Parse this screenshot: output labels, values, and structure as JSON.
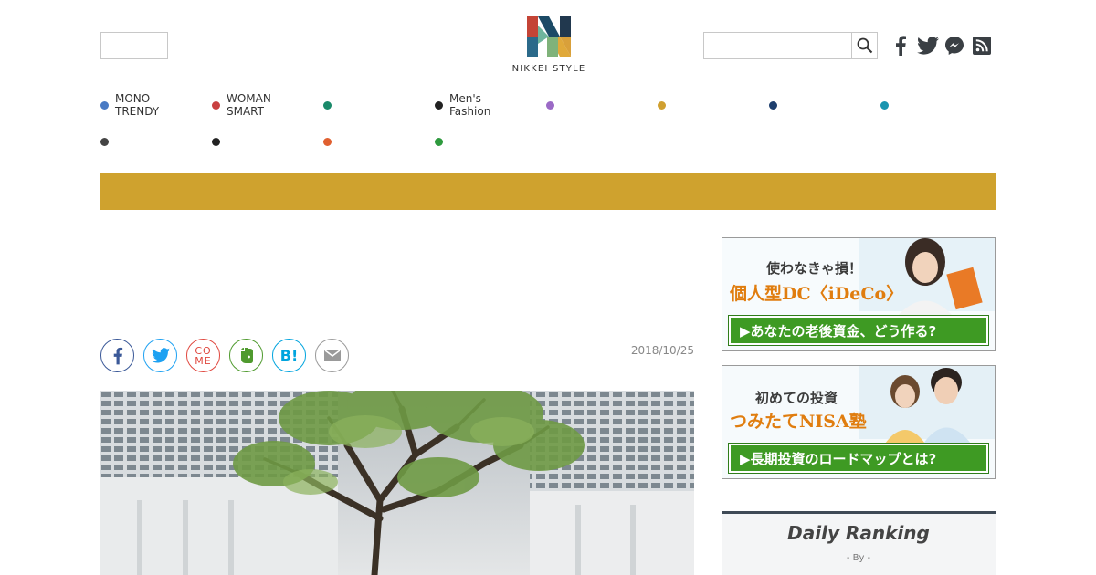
{
  "header": {
    "logo_text": "NIKKEI STYLE",
    "search": {
      "value": "",
      "placeholder": ""
    },
    "social": [
      "facebook-icon",
      "twitter-icon",
      "messenger-icon",
      "rss-icon"
    ]
  },
  "categories": [
    {
      "label": "MONO\nTRENDY",
      "color": "#4a7bc4"
    },
    {
      "label": "WOMAN\nSMART",
      "color": "#c94040"
    },
    {
      "label": "",
      "color": "#1a8a6a"
    },
    {
      "label": "Men's\nFashion",
      "color": "#222222"
    },
    {
      "label": "",
      "color": "#9b6ac6"
    },
    {
      "label": "",
      "color": "#d0a030"
    },
    {
      "label": "",
      "color": "#1e3f6e"
    },
    {
      "label": "",
      "color": "#1a95b0"
    },
    {
      "label": "",
      "color": "#444444"
    },
    {
      "label": "",
      "color": "#222222"
    },
    {
      "label": "",
      "color": "#e06030"
    },
    {
      "label": "",
      "color": "#2e9a3e"
    }
  ],
  "theme": {
    "gold_bar": "#cfa22e",
    "cta_green": "#3e9a23"
  },
  "share": {
    "buttons": [
      {
        "name": "facebook-share-button",
        "icon": "facebook-icon",
        "color": "#3b5998"
      },
      {
        "name": "twitter-share-button",
        "icon": "twitter-icon",
        "color": "#1da1f2"
      },
      {
        "name": "come-share-button",
        "icon": "come-icon",
        "color": "#e0483f"
      },
      {
        "name": "evernote-share-button",
        "icon": "evernote-icon",
        "color": "#4f9a2e"
      },
      {
        "name": "hatena-share-button",
        "icon": "hatena-icon",
        "color": "#00a4de"
      },
      {
        "name": "mail-share-button",
        "icon": "mail-icon",
        "color": "#999999"
      }
    ],
    "come_top": "CO",
    "come_bottom": "ME",
    "hatena_text": "B!"
  },
  "article": {
    "date": "2018/10/25"
  },
  "banners": [
    {
      "line1": "使わなきゃ損！",
      "line2": "個人型DC〈iDeCo〉",
      "cta": "▶あなたの老後資金、どう作る?"
    },
    {
      "line1": "初めての投資",
      "line2": "つみたてNISA塾",
      "cta": "▶長期投資のロードマップとは?"
    }
  ],
  "ranking": {
    "title": "Daily Ranking",
    "by": "- By  -"
  }
}
